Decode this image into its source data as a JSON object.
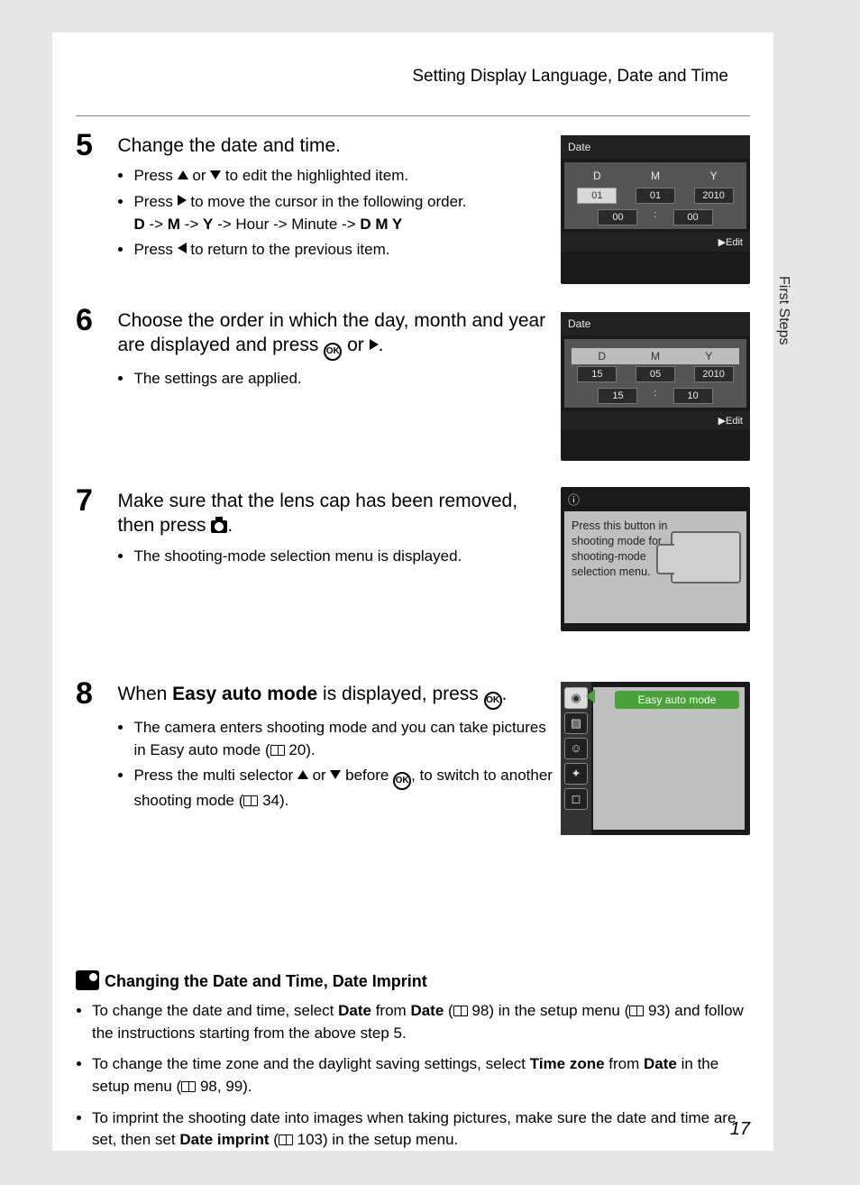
{
  "header": {
    "title": "Setting Display Language, Date and Time",
    "side_label": "First Steps",
    "page_number": "17"
  },
  "steps": {
    "5": {
      "num": "5",
      "title": "Change the date and time.",
      "b1a": "Press ",
      "b1b": " or ",
      "b1c": " to edit the highlighted item.",
      "b2a": "Press ",
      "b2b": " to move the cursor in the following order.",
      "order_d": "D",
      "order_m": "M",
      "order_y": "Y",
      "order_rest": " -> Hour -> Minute -> ",
      "order_dmy": "D M Y",
      "b3a": "Press ",
      "b3b": " to return to the previous item."
    },
    "6": {
      "num": "6",
      "title_a": "Choose the order in which the day, month and year are displayed and press ",
      "title_b": " or ",
      "title_c": ".",
      "b1": "The settings are applied."
    },
    "7": {
      "num": "7",
      "title_a": "Make sure that the lens cap has been removed, then press ",
      "title_b": ".",
      "b1": "The shooting-mode selection menu is displayed."
    },
    "8": {
      "num": "8",
      "title_a": "When ",
      "title_bold": "Easy auto mode",
      "title_b": " is displayed, press ",
      "title_c": ".",
      "b1a": "The camera enters shooting mode and you can take pictures in Easy auto mode (",
      "b1b": " 20).",
      "b2a": "Press the multi selector ",
      "b2b": " or ",
      "b2c": " before ",
      "b2d": ", to switch to another shooting mode (",
      "b2e": " 34)."
    }
  },
  "lcd5": {
    "title": "Date",
    "d": "D",
    "m": "M",
    "y": "Y",
    "vD": "01",
    "vM": "01",
    "vY": "2010",
    "vH": "00",
    "vMin": "00",
    "edit": "Edit"
  },
  "lcd6": {
    "title": "Date",
    "d": "D",
    "m": "M",
    "y": "Y",
    "vD": "15",
    "vM": "05",
    "vY": "2010",
    "vH": "15",
    "vMin": "10",
    "edit": "Edit"
  },
  "lcd7": {
    "info_icon": "ⓘ",
    "text": "Press this button in shooting mode for shooting-mode selection menu."
  },
  "lcd8": {
    "label": "Easy auto mode"
  },
  "note": {
    "heading": "Changing the Date and Time, Date Imprint",
    "n1a": "To change the date and time, select ",
    "n1_date1": "Date",
    "n1b": " from ",
    "n1_date2": "Date",
    "n1c": " (",
    "n1d": " 98) in the setup menu (",
    "n1e": " 93) and follow the instructions starting from the above step 5.",
    "n2a": "To change the time zone and the daylight saving settings, select ",
    "n2_tz": "Time zone",
    "n2b": " from ",
    "n2_date": "Date",
    "n2c": " in the setup menu (",
    "n2d": " 98, 99).",
    "n3a": "To imprint the shooting date into images when taking pictures, make sure the date and time are set, then set ",
    "n3_di": "Date imprint",
    "n3b": " (",
    "n3c": " 103) in the setup menu."
  }
}
